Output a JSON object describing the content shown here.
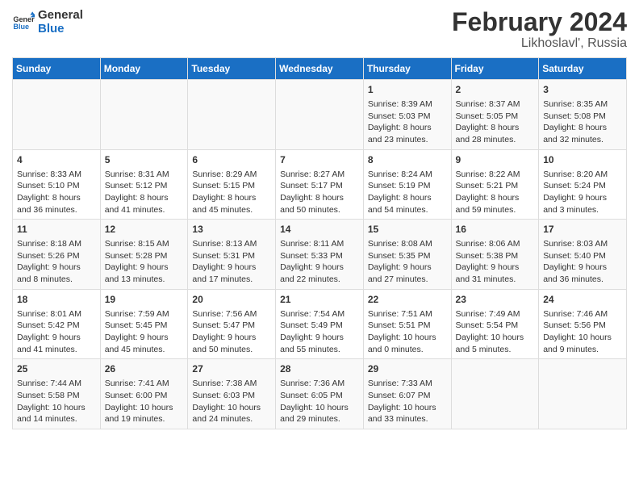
{
  "logo": {
    "line1": "General",
    "line2": "Blue"
  },
  "title": "February 2024",
  "subtitle": "Likhoslavl', Russia",
  "weekdays": [
    "Sunday",
    "Monday",
    "Tuesday",
    "Wednesday",
    "Thursday",
    "Friday",
    "Saturday"
  ],
  "weeks": [
    [
      {
        "day": "",
        "info": ""
      },
      {
        "day": "",
        "info": ""
      },
      {
        "day": "",
        "info": ""
      },
      {
        "day": "",
        "info": ""
      },
      {
        "day": "1",
        "info": "Sunrise: 8:39 AM\nSunset: 5:03 PM\nDaylight: 8 hours\nand 23 minutes."
      },
      {
        "day": "2",
        "info": "Sunrise: 8:37 AM\nSunset: 5:05 PM\nDaylight: 8 hours\nand 28 minutes."
      },
      {
        "day": "3",
        "info": "Sunrise: 8:35 AM\nSunset: 5:08 PM\nDaylight: 8 hours\nand 32 minutes."
      }
    ],
    [
      {
        "day": "4",
        "info": "Sunrise: 8:33 AM\nSunset: 5:10 PM\nDaylight: 8 hours\nand 36 minutes."
      },
      {
        "day": "5",
        "info": "Sunrise: 8:31 AM\nSunset: 5:12 PM\nDaylight: 8 hours\nand 41 minutes."
      },
      {
        "day": "6",
        "info": "Sunrise: 8:29 AM\nSunset: 5:15 PM\nDaylight: 8 hours\nand 45 minutes."
      },
      {
        "day": "7",
        "info": "Sunrise: 8:27 AM\nSunset: 5:17 PM\nDaylight: 8 hours\nand 50 minutes."
      },
      {
        "day": "8",
        "info": "Sunrise: 8:24 AM\nSunset: 5:19 PM\nDaylight: 8 hours\nand 54 minutes."
      },
      {
        "day": "9",
        "info": "Sunrise: 8:22 AM\nSunset: 5:21 PM\nDaylight: 8 hours\nand 59 minutes."
      },
      {
        "day": "10",
        "info": "Sunrise: 8:20 AM\nSunset: 5:24 PM\nDaylight: 9 hours\nand 3 minutes."
      }
    ],
    [
      {
        "day": "11",
        "info": "Sunrise: 8:18 AM\nSunset: 5:26 PM\nDaylight: 9 hours\nand 8 minutes."
      },
      {
        "day": "12",
        "info": "Sunrise: 8:15 AM\nSunset: 5:28 PM\nDaylight: 9 hours\nand 13 minutes."
      },
      {
        "day": "13",
        "info": "Sunrise: 8:13 AM\nSunset: 5:31 PM\nDaylight: 9 hours\nand 17 minutes."
      },
      {
        "day": "14",
        "info": "Sunrise: 8:11 AM\nSunset: 5:33 PM\nDaylight: 9 hours\nand 22 minutes."
      },
      {
        "day": "15",
        "info": "Sunrise: 8:08 AM\nSunset: 5:35 PM\nDaylight: 9 hours\nand 27 minutes."
      },
      {
        "day": "16",
        "info": "Sunrise: 8:06 AM\nSunset: 5:38 PM\nDaylight: 9 hours\nand 31 minutes."
      },
      {
        "day": "17",
        "info": "Sunrise: 8:03 AM\nSunset: 5:40 PM\nDaylight: 9 hours\nand 36 minutes."
      }
    ],
    [
      {
        "day": "18",
        "info": "Sunrise: 8:01 AM\nSunset: 5:42 PM\nDaylight: 9 hours\nand 41 minutes."
      },
      {
        "day": "19",
        "info": "Sunrise: 7:59 AM\nSunset: 5:45 PM\nDaylight: 9 hours\nand 45 minutes."
      },
      {
        "day": "20",
        "info": "Sunrise: 7:56 AM\nSunset: 5:47 PM\nDaylight: 9 hours\nand 50 minutes."
      },
      {
        "day": "21",
        "info": "Sunrise: 7:54 AM\nSunset: 5:49 PM\nDaylight: 9 hours\nand 55 minutes."
      },
      {
        "day": "22",
        "info": "Sunrise: 7:51 AM\nSunset: 5:51 PM\nDaylight: 10 hours\nand 0 minutes."
      },
      {
        "day": "23",
        "info": "Sunrise: 7:49 AM\nSunset: 5:54 PM\nDaylight: 10 hours\nand 5 minutes."
      },
      {
        "day": "24",
        "info": "Sunrise: 7:46 AM\nSunset: 5:56 PM\nDaylight: 10 hours\nand 9 minutes."
      }
    ],
    [
      {
        "day": "25",
        "info": "Sunrise: 7:44 AM\nSunset: 5:58 PM\nDaylight: 10 hours\nand 14 minutes."
      },
      {
        "day": "26",
        "info": "Sunrise: 7:41 AM\nSunset: 6:00 PM\nDaylight: 10 hours\nand 19 minutes."
      },
      {
        "day": "27",
        "info": "Sunrise: 7:38 AM\nSunset: 6:03 PM\nDaylight: 10 hours\nand 24 minutes."
      },
      {
        "day": "28",
        "info": "Sunrise: 7:36 AM\nSunset: 6:05 PM\nDaylight: 10 hours\nand 29 minutes."
      },
      {
        "day": "29",
        "info": "Sunrise: 7:33 AM\nSunset: 6:07 PM\nDaylight: 10 hours\nand 33 minutes."
      },
      {
        "day": "",
        "info": ""
      },
      {
        "day": "",
        "info": ""
      }
    ]
  ]
}
